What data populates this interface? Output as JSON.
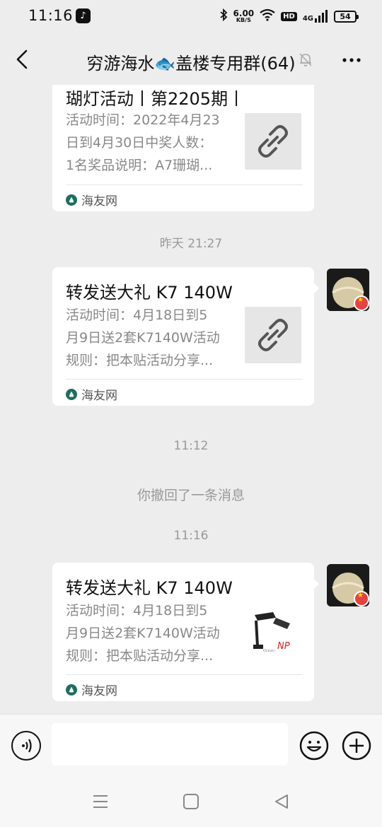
{
  "status_bar": {
    "time": "11:16",
    "speed_value": "6.00",
    "speed_unit": "KB/S",
    "hd": "HD",
    "network": "4G",
    "battery": "54",
    "icons": [
      "tiktok-icon",
      "bluetooth-icon",
      "wifi-icon",
      "signal-icon",
      "battery-icon"
    ]
  },
  "header": {
    "title": "穷游海水🐟盖楼专用群(64)",
    "icons": [
      "back-arrow-icon",
      "mute-bell-icon",
      "more-icon"
    ]
  },
  "messages": [
    {
      "type": "link-card",
      "title": "瑚灯活动丨第2205期丨",
      "desc_lines": [
        "活动时间：2022年4月23",
        "日到4月30日中奖人数：",
        "1名奖品说明：A7珊瑚..."
      ],
      "source": "海友网",
      "thumb": "link-icon"
    },
    {
      "type": "timestamp",
      "text": "昨天 21:27"
    },
    {
      "type": "link-card",
      "title": "转发送大礼 K7 140W",
      "desc_lines": [
        "活动时间：4月18日到5",
        "月9日送2套K7140W活动",
        "规则：把本贴活动分享..."
      ],
      "source": "海友网",
      "thumb": "link-icon"
    },
    {
      "type": "timestamp",
      "text": "11:12"
    },
    {
      "type": "system",
      "text": "你撤回了一条消息"
    },
    {
      "type": "timestamp",
      "text": "11:16"
    },
    {
      "type": "link-card",
      "title": "转发送大礼 K7 140W",
      "desc_lines": [
        "活动时间：4月18日到5",
        "月9日送2套K7140W活动",
        "规则：把本贴活动分享..."
      ],
      "source": "海友网",
      "thumb": "lamp-product-image"
    }
  ],
  "input_bar": {
    "placeholder": "",
    "icons": [
      "voice-icon",
      "emoji-icon",
      "plus-icon"
    ]
  },
  "system_nav": {
    "icons": [
      "menu-icon",
      "home-icon",
      "back-icon"
    ]
  }
}
